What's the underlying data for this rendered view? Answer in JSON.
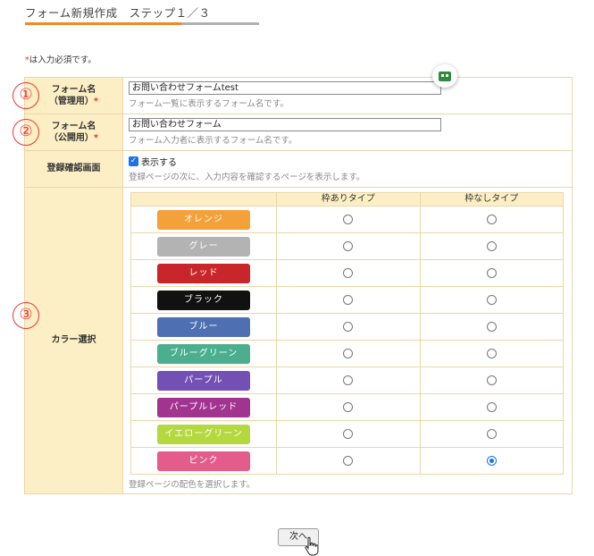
{
  "header": {
    "title": "フォーム新規作成　ステップ１／３",
    "progress_fraction": 0.667
  },
  "required_note": {
    "mark": "*",
    "text": "は入力必須です。"
  },
  "fields": {
    "name_admin": {
      "badge": "①",
      "label_line1": "フォーム名",
      "label_line2": "（管理用）",
      "required_mark": "*",
      "value": "お問い合わせフォームtest",
      "hint": "フォーム一覧に表示するフォーム名です。"
    },
    "name_public": {
      "badge": "②",
      "label_line1": "フォーム名",
      "label_line2": "（公開用）",
      "required_mark": "*",
      "value": "お問い合わせフォーム",
      "hint": "フォーム入力者に表示するフォーム名です。"
    },
    "confirm_page": {
      "label": "登録確認画面",
      "checkbox_label": "表示する",
      "checked": true,
      "hint": "登録ページの次に、入力内容を確認するページを表示します。"
    },
    "color": {
      "badge": "③",
      "label": "カラー選択",
      "col_framed": "枠ありタイプ",
      "col_frameless": "枠なしタイプ",
      "hint": "登録ページの配色を選択します。",
      "options": [
        {
          "label": "オレンジ",
          "color": "#f5a13a",
          "framed": false,
          "frameless": false
        },
        {
          "label": "グレー",
          "color": "#b3b3b3",
          "framed": false,
          "frameless": false
        },
        {
          "label": "レッド",
          "color": "#c8262b",
          "framed": false,
          "frameless": false
        },
        {
          "label": "ブラック",
          "color": "#111111",
          "framed": false,
          "frameless": false
        },
        {
          "label": "ブルー",
          "color": "#4f6fb3",
          "framed": false,
          "frameless": false
        },
        {
          "label": "ブルーグリーン",
          "color": "#4aae8f",
          "framed": false,
          "frameless": false
        },
        {
          "label": "パープル",
          "color": "#7350b4",
          "framed": false,
          "frameless": false
        },
        {
          "label": "パープルレッド",
          "color": "#a1348f",
          "framed": false,
          "frameless": false
        },
        {
          "label": "イエローグリーン",
          "color": "#b4d93e",
          "framed": false,
          "frameless": false
        },
        {
          "label": "ピンク",
          "color": "#e35c8b",
          "framed": false,
          "frameless": true
        }
      ]
    }
  },
  "footer": {
    "next_label": "次へ"
  },
  "icons": {
    "robot": "robot-icon",
    "cursor": "hand-pointer-icon"
  }
}
